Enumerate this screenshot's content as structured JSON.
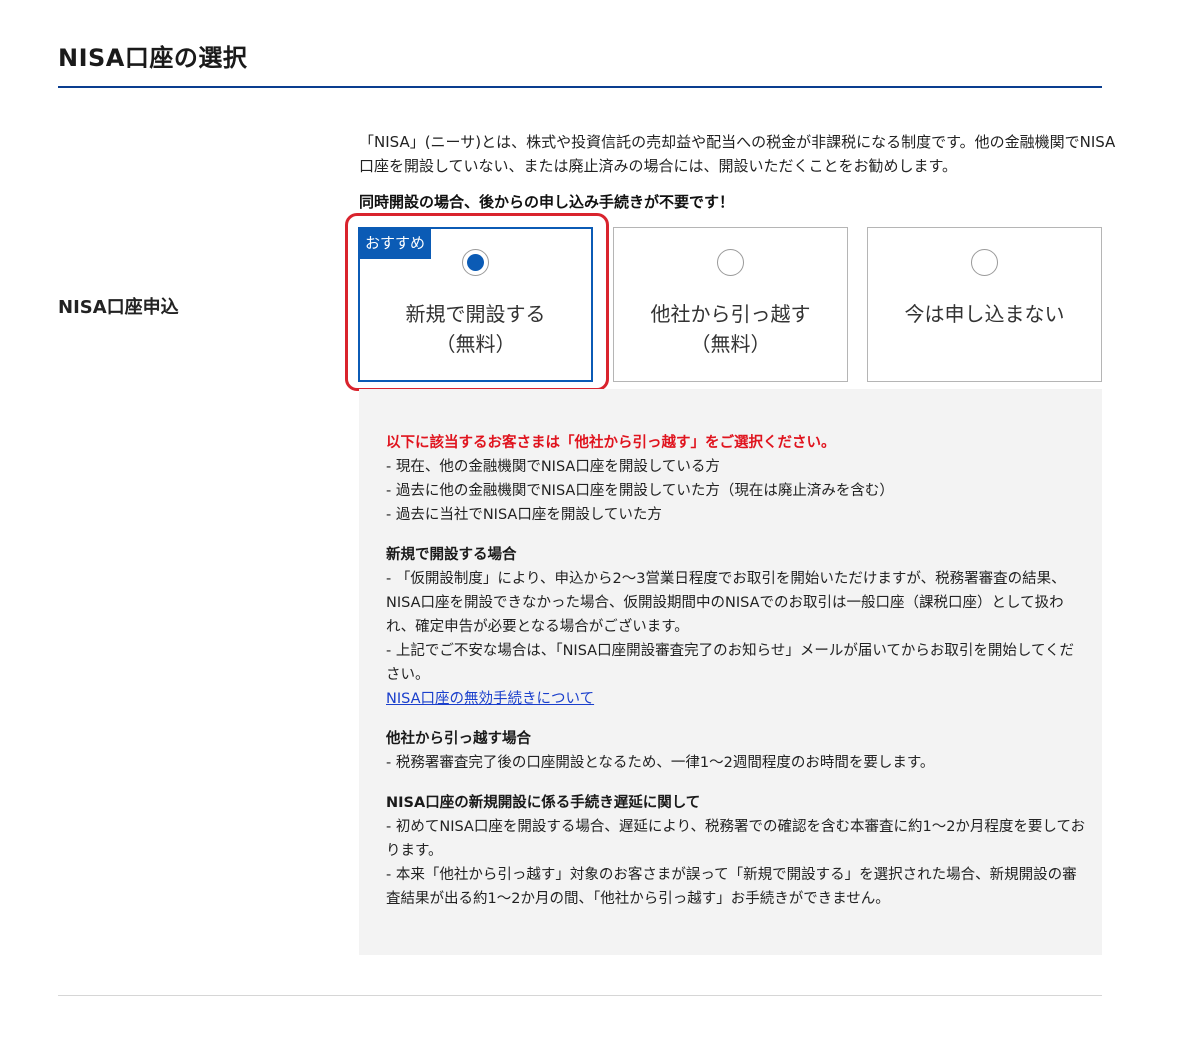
{
  "page": {
    "title": "NISA口座の選択"
  },
  "row": {
    "label": "NISA口座申込"
  },
  "intro": {
    "text": "「NISA」(ニーサ)とは、株式や投資信託の売却益や配当への税金が非課税になる制度です。他の金融機関でNISA口座を開設していない、または廃止済みの場合には、開設いただくことをお勧めします。",
    "emphasis": "同時開設の場合、後からの申し込み手続きが不要です！"
  },
  "options": [
    {
      "badge": "おすすめ",
      "label": "新規で開設する",
      "sub": "（無料）",
      "selected": true
    },
    {
      "badge": "",
      "label": "他社から引っ越す",
      "sub": "（無料）",
      "selected": false
    },
    {
      "badge": "",
      "label": "今は申し込まない",
      "sub": "",
      "selected": false
    }
  ],
  "info": {
    "warning": "以下に該当するお客さまは「他社から引っ越す」をご選択ください。",
    "warning_items": [
      "- 現在、他の金融機関でNISA口座を開設している方",
      "- 過去に他の金融機関でNISA口座を開設していた方（現在は廃止済みを含む）",
      "- 過去に当社でNISA口座を開設していた方"
    ],
    "new": {
      "heading": "新規で開設する場合",
      "line1": "- 「仮開設制度」により、申込から2〜3営業日程度でお取引を開始いただけますが、税務署審査の結果、NISA口座を開設できなかった場合、仮開設期間中のNISAでのお取引は一般口座（課税口座）として扱われ、確定申告が必要となる場合がございます。",
      "line2": "- 上記でご不安な場合は、「NISA口座開設審査完了のお知らせ」メールが届いてからお取引を開始してください。",
      "link": "NISA口座の無効手続きについて"
    },
    "transfer": {
      "heading": "他社から引っ越す場合",
      "line1": "- 税務署審査完了後の口座開設となるため、一律1〜2週間程度のお時間を要します。"
    },
    "delay": {
      "heading": "NISA口座の新規開設に係る手続き遅延に関して",
      "line1": "- 初めてNISA口座を開設する場合、遅延により、税務署での確認を含む本審査に約1〜2か月程度を要しております。",
      "line2": "- 本来「他社から引っ越す」対象のお客さまが誤って「新規で開設する」を選択された場合、新規開設の審査結果が出る約1〜2か月の間、「他社から引っ越す」お手続きができません。"
    }
  },
  "colors": {
    "accent": "#0b5bb5",
    "highlight": "#d9232d",
    "warning": "#e0141e",
    "link": "#1a3fcc",
    "panel": "#f3f3f3",
    "title_rule": "#0a3d8f"
  }
}
